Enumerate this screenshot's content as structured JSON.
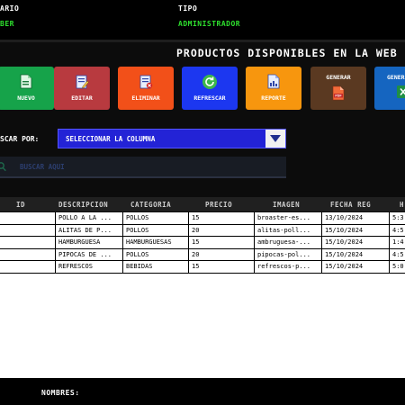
{
  "header": {
    "user_label": "ARIO",
    "user_value": "BER",
    "type_label": "TIPO",
    "type_value": "ADMINISTRADOR"
  },
  "title": "PRODUCTOS DISPONIBLES EN LA WEB",
  "toolbar": [
    {
      "label": "NUEVO",
      "color": "#16a34a",
      "icon": "new-document-icon"
    },
    {
      "label": "EDITAR",
      "color": "#b83a3f",
      "icon": "edit-document-icon"
    },
    {
      "label": "ELIMINAR",
      "color": "#f25019",
      "icon": "delete-document-icon"
    },
    {
      "label": "REFRESCAR",
      "color": "#1c37f0",
      "icon": "refresh-icon"
    },
    {
      "label": "REPORTE",
      "color": "#f7960e",
      "icon": "report-document-icon"
    },
    {
      "label": "GENERAR",
      "color": "#5a3921",
      "icon": "pdf-icon"
    },
    {
      "label": "GENER",
      "color": "#1565c0",
      "icon": "excel-icon"
    }
  ],
  "search": {
    "label": "SCAR POR:",
    "column_select": "SELECCIONAR LA COLUMNA",
    "placeholder": "BUSCAR AQUI"
  },
  "table": {
    "columns": [
      "ID",
      "DESCRIPCION",
      "CATEGORIA",
      "PRECIO",
      "IMAGEN",
      "FECHA REG",
      "H"
    ],
    "rows": [
      [
        "",
        "POLLO A LA ...",
        "POLLOS",
        "15",
        "broaster-es...",
        "13/10/2024",
        "5:3"
      ],
      [
        "",
        "ALITAS DE P...",
        "POLLOS",
        "20",
        "alitas-poll...",
        "15/10/2024",
        "4:5"
      ],
      [
        "",
        "HAMBURGUESA",
        "HAMBURGUESAS",
        "15",
        "ambruguesa-...",
        "15/10/2024",
        "1:4"
      ],
      [
        "",
        "PIPOCAS DE ...",
        "POLLOS",
        "20",
        "pipocas-pol...",
        "15/10/2024",
        "4:5"
      ],
      [
        "",
        "REFRESCOS",
        "BEBIDAS",
        "15",
        "refrescos-p...",
        "15/10/2024",
        "5:0"
      ]
    ]
  },
  "footer": {
    "names_label": "NOMBRES:"
  }
}
